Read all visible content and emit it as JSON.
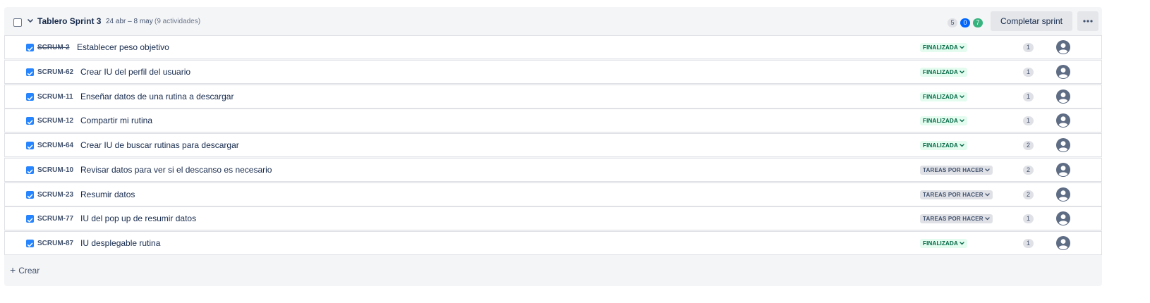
{
  "sprint": {
    "title": "Tablero Sprint 3",
    "dates": "24 abr – 8 may",
    "issue_count": "(9 actividades)",
    "counts": {
      "todo": "5",
      "in_progress": "0",
      "done": "7"
    },
    "complete_label": "Completar sprint",
    "more_icon": "ellipsis-icon"
  },
  "issues": [
    {
      "key": "SCRUM-2",
      "summary": "Establecer peso objetivo",
      "status": "FINALIZADA",
      "points": "1",
      "key_struck": true
    },
    {
      "key": "SCRUM-62",
      "summary": "Crear IU del perfil del usuario",
      "status": "FINALIZADA",
      "points": "1"
    },
    {
      "key": "SCRUM-11",
      "summary": "Enseñar datos de una rutina a descargar",
      "status": "FINALIZADA",
      "points": "1"
    },
    {
      "key": "SCRUM-12",
      "summary": "Compartir mi rutina",
      "status": "FINALIZADA",
      "points": "1"
    },
    {
      "key": "SCRUM-64",
      "summary": "Crear IU de buscar rutinas para descargar",
      "status": "FINALIZADA",
      "points": "2"
    },
    {
      "key": "SCRUM-10",
      "summary": "Revisar datos para ver si el descanso es necesario",
      "status": "TAREAS POR HACER",
      "points": "2"
    },
    {
      "key": "SCRUM-23",
      "summary": "Resumir datos",
      "status": "TAREAS POR HACER",
      "points": "2"
    },
    {
      "key": "SCRUM-77",
      "summary": "IU del pop up de resumir datos",
      "status": "TAREAS POR HACER",
      "points": "1"
    },
    {
      "key": "SCRUM-87",
      "summary": "IU desplegable rutina",
      "status": "FINALIZADA",
      "points": "1"
    }
  ],
  "create_label": "Crear",
  "colors": {
    "done_bg": "#e3fcef",
    "done_text": "#006644",
    "todo_bg": "#dfe1e6",
    "todo_text": "#42526e",
    "checkbox": "#2684ff",
    "in_progress_badge": "#0065ff",
    "done_badge": "#36b37e"
  }
}
